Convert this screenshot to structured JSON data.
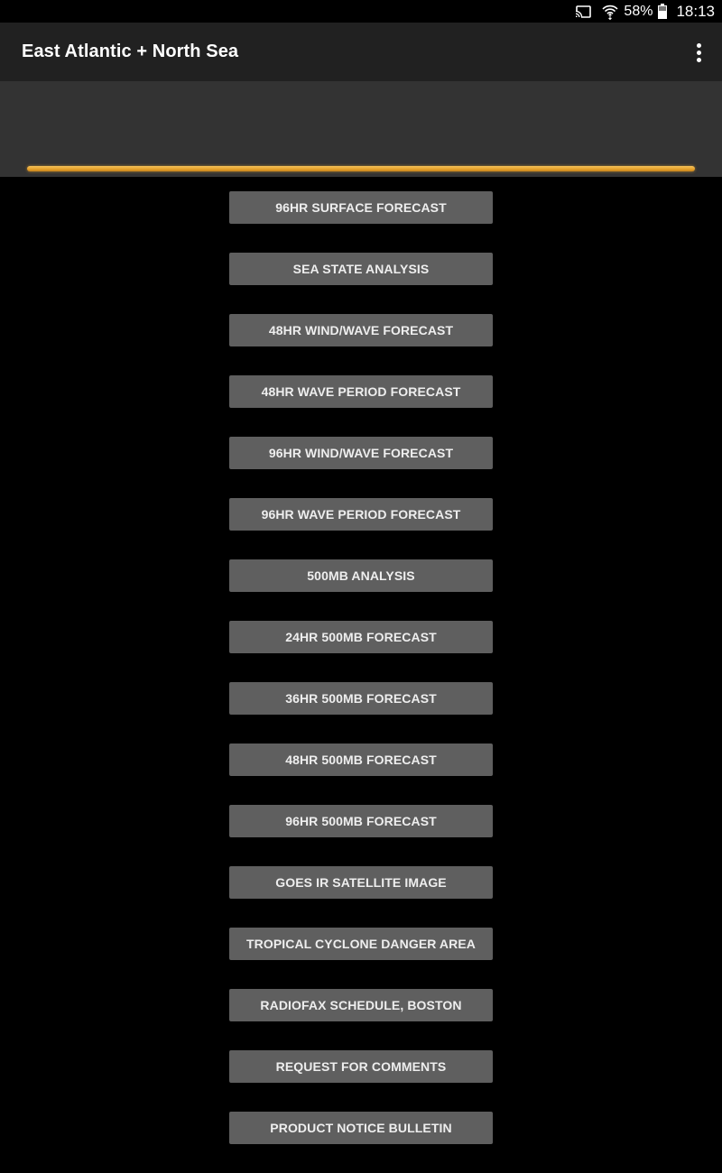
{
  "status_bar": {
    "icons": [
      "cast-icon",
      "wifi-icon",
      "battery-icon"
    ],
    "battery_percent": "58%",
    "time": "18:13"
  },
  "toolbar": {
    "title": "East Atlantic + North Sea",
    "overflow_icon": "more-vert-icon"
  },
  "progress": {
    "value_percent": 100,
    "color": "#e8a632"
  },
  "products": [
    {
      "label": "96HR SURFACE FORECAST"
    },
    {
      "label": "SEA STATE ANALYSIS"
    },
    {
      "label": "48HR WIND/WAVE FORECAST"
    },
    {
      "label": "48HR WAVE PERIOD FORECAST"
    },
    {
      "label": "96HR WIND/WAVE FORECAST"
    },
    {
      "label": "96HR WAVE PERIOD FORECAST"
    },
    {
      "label": "500MB ANALYSIS"
    },
    {
      "label": "24HR 500MB FORECAST"
    },
    {
      "label": "36HR 500MB FORECAST"
    },
    {
      "label": "48HR 500MB FORECAST"
    },
    {
      "label": "96HR 500MB FORECAST"
    },
    {
      "label": "GOES IR SATELLITE IMAGE"
    },
    {
      "label": "TROPICAL CYCLONE DANGER AREA"
    },
    {
      "label": "RADIOFAX SCHEDULE, BOSTON"
    },
    {
      "label": "REQUEST FOR COMMENTS"
    },
    {
      "label": "PRODUCT NOTICE BULLETIN"
    }
  ]
}
